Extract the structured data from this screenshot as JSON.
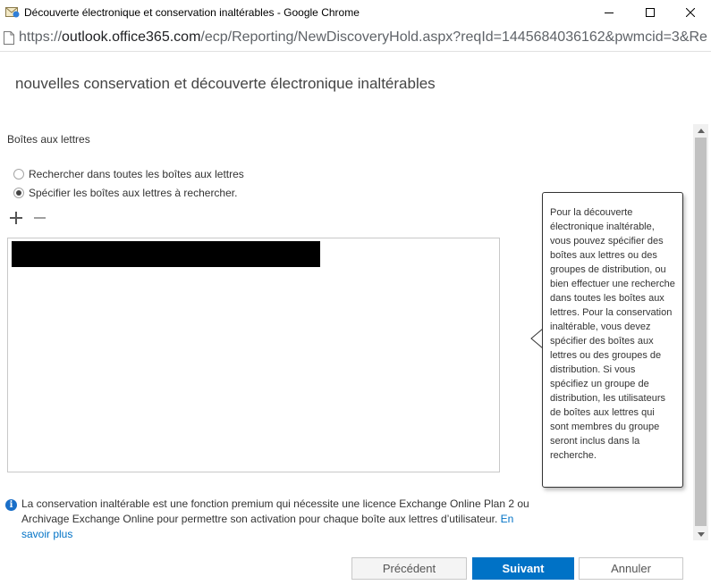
{
  "window": {
    "title": "Découverte électronique et conservation inaltérables - Google Chrome"
  },
  "address": {
    "scheme": "https://",
    "host": "outlook.office365.com",
    "path": "/ecp/Reporting/NewDiscoveryHold.aspx?reqId=1445684036162&pwmcid=3&Re"
  },
  "page": {
    "title": "nouvelles conservation et découverte électronique inaltérables",
    "section_label": "Boîtes aux lettres",
    "radio_all": "Rechercher dans toutes les boîtes aux lettres",
    "radio_specify": "Spécifier les boîtes aux lettres à rechercher.",
    "selected_radio": "specify",
    "mailbox_items": [
      "[redacted]"
    ]
  },
  "callout": {
    "text": "Pour la découverte électronique inaltérable, vous pouvez spécifier des boîtes aux lettres ou des groupes de distribution, ou bien effectuer une recherche dans toutes les boîtes aux lettres. Pour la conservation inaltérable, vous devez spécifier des boîtes aux lettres ou des groupes de distribution. Si vous spécifiez un groupe de distribution, les utilisateurs de boîtes aux lettres qui sont membres du groupe seront inclus dans la recherche."
  },
  "info": {
    "text": "La conservation inaltérable est une fonction premium qui nécessite une licence Exchange Online Plan 2 ou Archivage Exchange Online pour permettre son activation pour chaque boîte aux lettres d’utilisateur. ",
    "link": "En savoir plus"
  },
  "buttons": {
    "previous": "Précédent",
    "next": "Suivant",
    "cancel": "Annuler"
  },
  "colors": {
    "accent": "#0072c6",
    "info_icon": "#1a6fc8"
  }
}
